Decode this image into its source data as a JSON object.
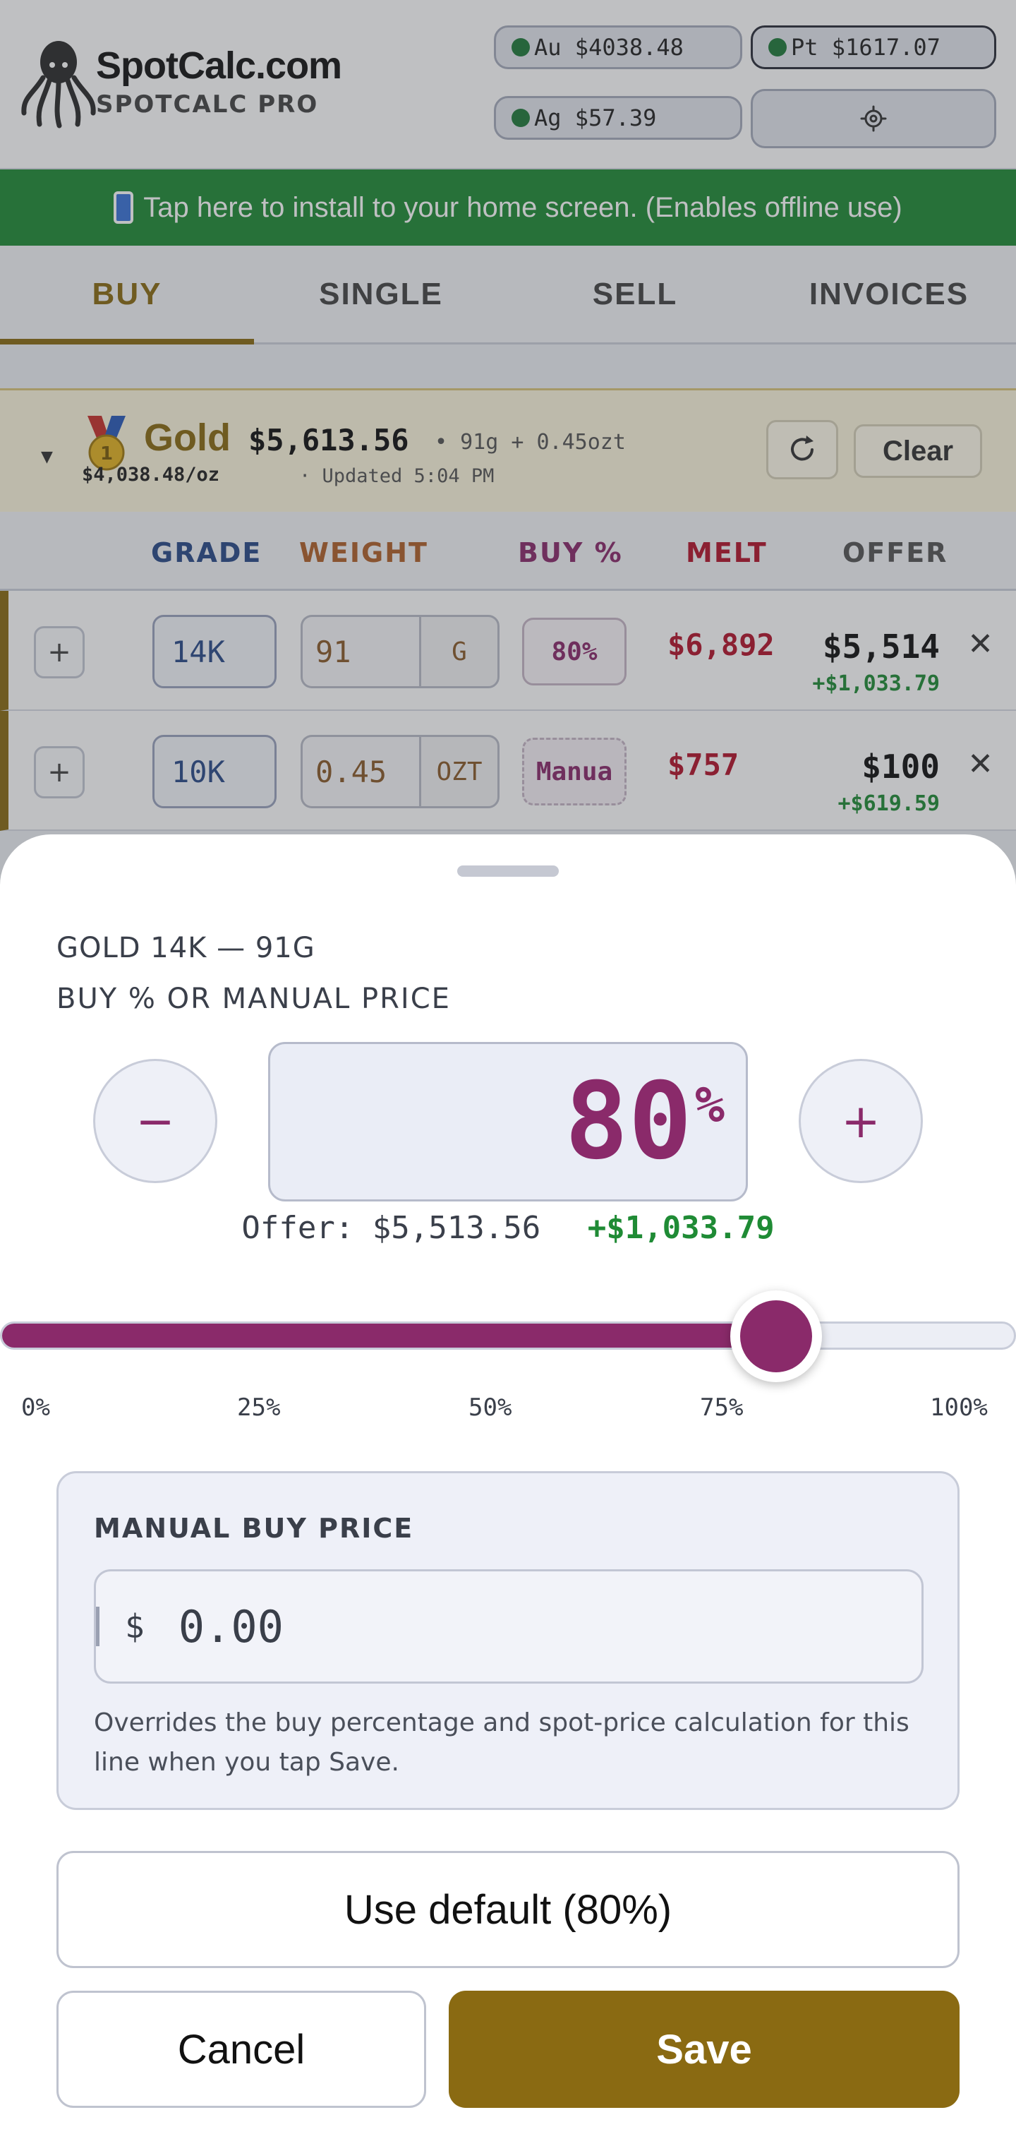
{
  "header": {
    "brand": "SpotCalc.com",
    "brand_sub": "SPOTCALC PRO",
    "prices": {
      "au": "Au $4038.48",
      "pt": "Pt $1617.07",
      "ag": "Ag $57.39"
    },
    "settings_icon": "gear-icon"
  },
  "banner": {
    "text": "Tap here to install to your home screen. (Enables offline use)"
  },
  "tabs": [
    {
      "label": "BUY",
      "active": true
    },
    {
      "label": "SINGLE",
      "active": false
    },
    {
      "label": "SELL",
      "active": false
    },
    {
      "label": "INVOICES",
      "active": false
    }
  ],
  "gold": {
    "name": "Gold",
    "total": "$5,613.56",
    "weight": "• 91g + 0.45ozt",
    "spot": "$4,038.48/oz",
    "updated": "· Updated 5:04 PM",
    "clear_label": "Clear"
  },
  "columns": {
    "grade": "GRADE",
    "weight": "WEIGHT",
    "buy_pct": "BUY %",
    "melt": "MELT",
    "offer": "OFFER"
  },
  "rows": [
    {
      "grade": "14K",
      "weight": "91",
      "unit": "G",
      "pct": "80%",
      "melt": "$6,892",
      "offer": "$5,514",
      "diff": "+$1,033.79"
    },
    {
      "grade": "10K",
      "weight": "0.45",
      "unit": "OZT",
      "pct": "Manua",
      "melt": "$757",
      "offer": "$100",
      "diff": "+$619.59"
    }
  ],
  "sheet": {
    "title": "GOLD 14K — 91G",
    "subtitle": "BUY % OR MANUAL PRICE",
    "minus_label": "−",
    "plus_label": "+",
    "pct_value": "80",
    "pct_symbol": "%",
    "offer_label": "Offer: $5,513.56",
    "offer_gain": "+$1,033.79",
    "slider": {
      "value": 0.8,
      "ticks": [
        "0%",
        "25%",
        "50%",
        "75%",
        "100%"
      ]
    },
    "manual": {
      "title": "MANUAL BUY PRICE",
      "currency": "$",
      "placeholder": "0.00",
      "help": "Overrides the buy percentage and spot-price calculation for this line when you tap Save."
    },
    "default_label": "Use default (80%)",
    "cancel_label": "Cancel",
    "save_label": "Save"
  },
  "colors": {
    "accent_gold": "#8a6a12",
    "accent_purple": "#8a2a6a",
    "gain_green": "#1f8b35",
    "melt_red": "#b3142b"
  }
}
